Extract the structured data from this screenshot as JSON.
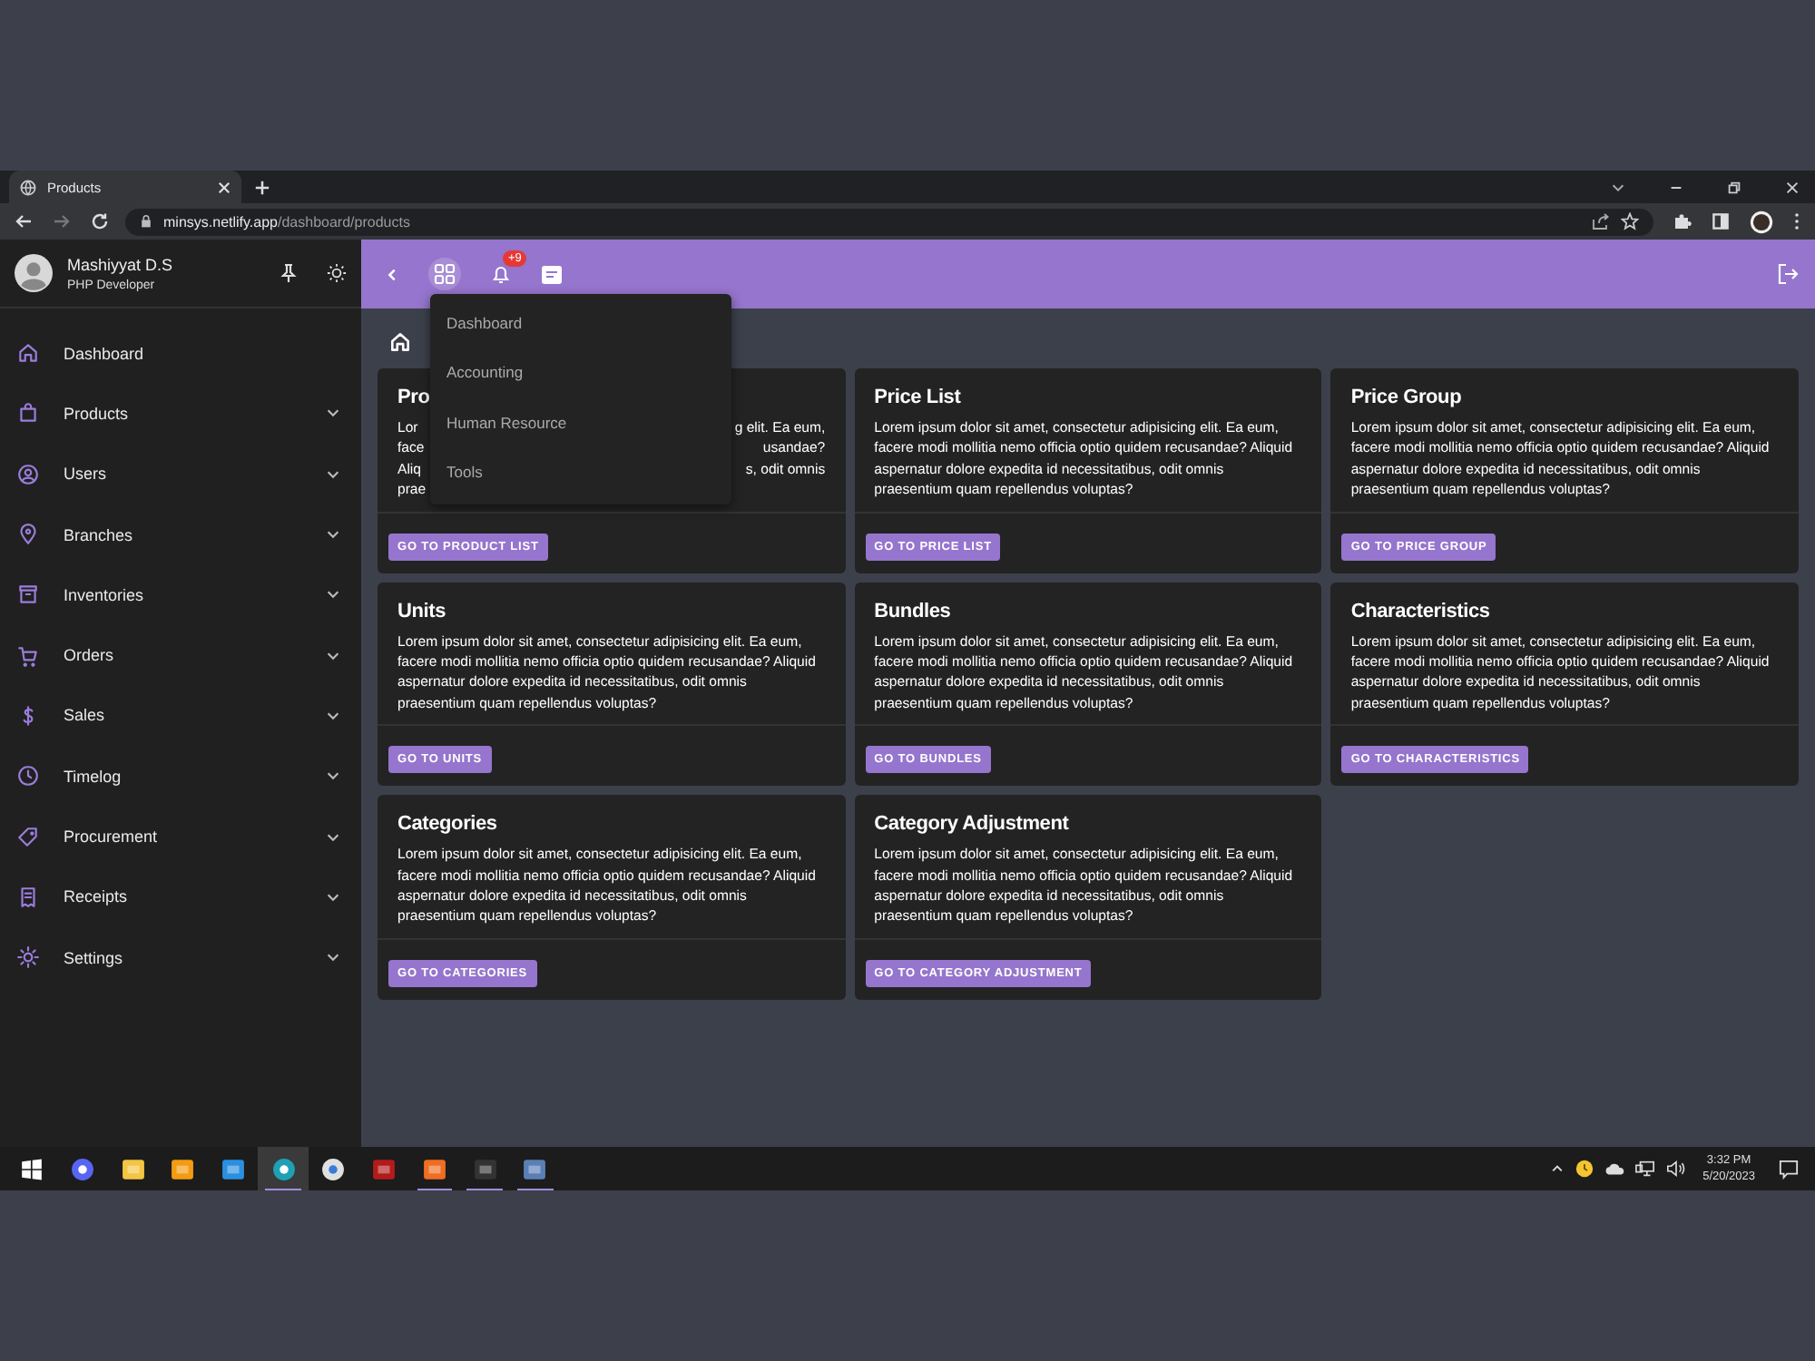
{
  "browser": {
    "tab_title": "Products",
    "url_host": "minsys.netlify.app",
    "url_path": "/dashboard/products"
  },
  "user": {
    "name": "Mashiyyat D.S",
    "role": "PHP Developer"
  },
  "sidebar": {
    "items": [
      {
        "label": "Dashboard",
        "has_submenu": false
      },
      {
        "label": "Products",
        "has_submenu": true
      },
      {
        "label": "Users",
        "has_submenu": true
      },
      {
        "label": "Branches",
        "has_submenu": true
      },
      {
        "label": "Inventories",
        "has_submenu": true
      },
      {
        "label": "Orders",
        "has_submenu": true
      },
      {
        "label": "Sales",
        "has_submenu": true
      },
      {
        "label": "Timelog",
        "has_submenu": true
      },
      {
        "label": "Procurement",
        "has_submenu": true
      },
      {
        "label": "Receipts",
        "has_submenu": true
      },
      {
        "label": "Settings",
        "has_submenu": true
      }
    ]
  },
  "topbar": {
    "notification_count": "+9"
  },
  "apps_menu": {
    "items": [
      "Dashboard",
      "Accounting",
      "Human Resource",
      "Tools"
    ]
  },
  "cards": [
    {
      "kind": "covered",
      "title": "Pro",
      "lines": [
        {
          "left": "Lor",
          "right": "g elit. Ea eum,"
        },
        {
          "left": "face",
          "right": "usandae?"
        },
        {
          "left": "Aliq",
          "right": "s, odit omnis"
        },
        {
          "left": "prae"
        }
      ],
      "button": "GO TO PRODUCT LIST"
    },
    {
      "kind": "full",
      "title": "Price List",
      "text": "Lorem ipsum dolor sit amet, consectetur adipisicing elit. Ea eum, facere modi mollitia nemo officia optio quidem recusandae? Aliquid aspernatur dolore expedita id necessitatibus, odit omnis praesentium quam repellendus voluptas?",
      "button": "GO TO PRICE LIST"
    },
    {
      "kind": "full",
      "title": "Price Group",
      "text": "Lorem ipsum dolor sit amet, consectetur adipisicing elit. Ea eum, facere modi mollitia nemo officia optio quidem recusandae? Aliquid aspernatur dolore expedita id necessitatibus, odit omnis praesentium quam repellendus voluptas?",
      "button": "GO TO PRICE GROUP"
    },
    {
      "kind": "full",
      "title": "Units",
      "text": "Lorem ipsum dolor sit amet, consectetur adipisicing elit. Ea eum, facere modi mollitia nemo officia optio quidem recusandae? Aliquid aspernatur dolore expedita id necessitatibus, odit omnis praesentium quam repellendus voluptas?",
      "button": "GO TO UNITS"
    },
    {
      "kind": "full",
      "title": "Bundles",
      "text": "Lorem ipsum dolor sit amet, consectetur adipisicing elit. Ea eum, facere modi mollitia nemo officia optio quidem recusandae? Aliquid aspernatur dolore expedita id necessitatibus, odit omnis praesentium quam repellendus voluptas?",
      "button": "GO TO BUNDLES"
    },
    {
      "kind": "full",
      "title": "Characteristics",
      "text": "Lorem ipsum dolor sit amet, consectetur adipisicing elit. Ea eum, facere modi mollitia nemo officia optio quidem recusandae? Aliquid aspernatur dolore expedita id necessitatibus, odit omnis praesentium quam repellendus voluptas?",
      "button": "GO TO CHARACTERISTICS"
    },
    {
      "kind": "full",
      "title": "Categories",
      "text": "Lorem ipsum dolor sit amet, consectetur adipisicing elit. Ea eum, facere modi mollitia nemo officia optio quidem recusandae? Aliquid aspernatur dolore expedita id necessitatibus, odit omnis praesentium quam repellendus voluptas?",
      "button": "GO TO CATEGORIES"
    },
    {
      "kind": "full",
      "title": "Category Adjustment",
      "text": "Lorem ipsum dolor sit amet, consectetur adipisicing elit. Ea eum, facere modi mollitia nemo officia optio quidem recusandae? Aliquid aspernatur dolore expedita id necessitatibus, odit omnis praesentium quam repellendus voluptas?",
      "button": "GO TO CATEGORY ADJUSTMENT"
    }
  ],
  "taskbar": {
    "apps": [
      {
        "selected": false,
        "running": false
      },
      {
        "selected": false,
        "running": false
      },
      {
        "selected": false,
        "running": false
      },
      {
        "selected": false,
        "running": false
      },
      {
        "selected": false,
        "running": false
      },
      {
        "selected": true,
        "running": true
      },
      {
        "selected": false,
        "running": false
      },
      {
        "selected": false,
        "running": false
      },
      {
        "selected": false,
        "running": true
      },
      {
        "selected": false,
        "running": true
      },
      {
        "selected": false,
        "running": true
      }
    ],
    "time": "3:32 PM",
    "date": "5/20/2023"
  }
}
